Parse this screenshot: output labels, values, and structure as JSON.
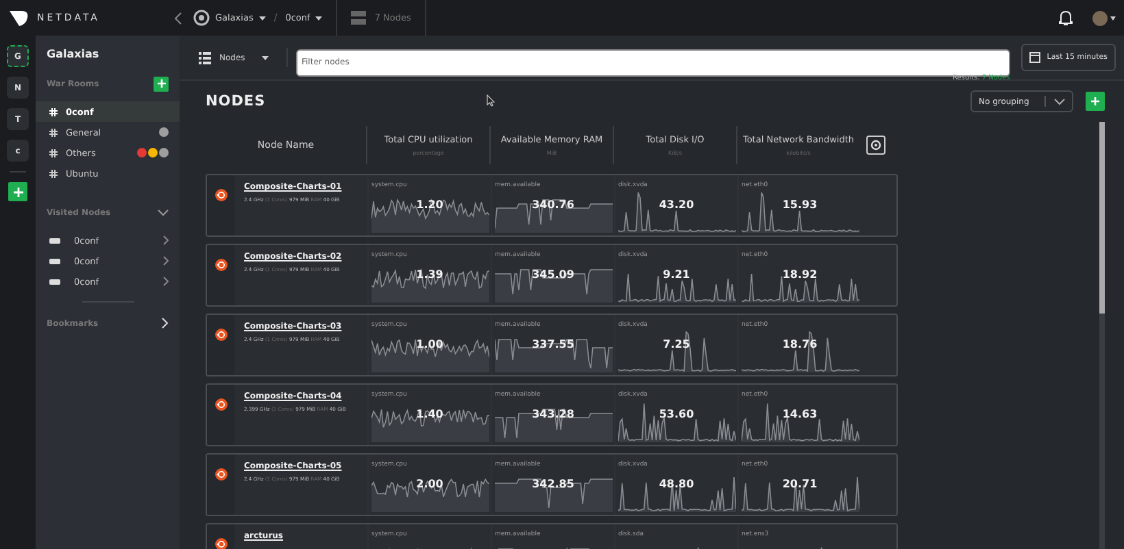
{
  "topbar": {
    "logo": "NETDATA",
    "space": "Galaxias",
    "separator": "/",
    "room": "0conf",
    "nodes_count": "7 Nodes"
  },
  "rail": [
    {
      "label": "G",
      "selected": true
    },
    {
      "label": "N",
      "selected": false
    },
    {
      "label": "T",
      "selected": false
    },
    {
      "label": "c",
      "selected": false
    }
  ],
  "sidebar": {
    "title": "Galaxias",
    "war_rooms_label": "War Rooms",
    "rooms": [
      {
        "name": "0conf",
        "selected": true
      },
      {
        "name": "General",
        "selected": false,
        "dots": [
          {
            "color": "#9e9e9e"
          }
        ]
      },
      {
        "name": "Others",
        "selected": false,
        "dots": [
          {
            "color": "#e53935"
          },
          {
            "color": "#f5b800"
          },
          {
            "color": "#9e9e9e"
          }
        ]
      },
      {
        "name": "Ubuntu",
        "selected": false
      }
    ],
    "visited_label": "Visited Nodes",
    "visited_expanded": true,
    "visited": [
      "0conf",
      "0conf",
      "0conf"
    ],
    "bookmarks_label": "Bookmarks"
  },
  "toolbar": {
    "view": "Nodes",
    "filter_placeholder": "Filter nodes",
    "time_range": "Last 15 minutes",
    "results_label": "Results:",
    "results_value": "7 Nodes"
  },
  "heading": "NODES",
  "grouping": "No grouping",
  "columns": [
    {
      "title": "Node Name"
    },
    {
      "title": "Total CPU utilization",
      "unit": "percentage"
    },
    {
      "title": "Available Memory RAM",
      "unit": "MiB"
    },
    {
      "title": "Total Disk I/O",
      "unit": "KiB/s"
    },
    {
      "title": "Total Network Bandwidth",
      "unit": "kilobits/s"
    }
  ],
  "nodes": [
    {
      "name": "Composite-Charts-01",
      "specs": [
        {
          "text": "2.4 GHz",
          "muted": false
        },
        {
          "text": "(1 Cores)",
          "muted": true
        },
        {
          "text": "979 MiB",
          "muted": false
        },
        {
          "text": "RAM",
          "muted": true
        },
        {
          "text": "40 GiB",
          "muted": false
        }
      ],
      "metrics": [
        {
          "label": "system.cpu",
          "value": "1.20"
        },
        {
          "label": "mem.available",
          "value": "340.76"
        },
        {
          "label": "disk.xvda",
          "value": "43.20"
        },
        {
          "label": "net.eth0",
          "value": "15.93"
        }
      ]
    },
    {
      "name": "Composite-Charts-02",
      "specs": [
        {
          "text": "2.4 GHz",
          "muted": false
        },
        {
          "text": "(1 Cores)",
          "muted": true
        },
        {
          "text": "979 MiB",
          "muted": false
        },
        {
          "text": "RAM",
          "muted": true
        },
        {
          "text": "40 GiB",
          "muted": false
        }
      ],
      "metrics": [
        {
          "label": "system.cpu",
          "value": "1.39"
        },
        {
          "label": "mem.available",
          "value": "345.09"
        },
        {
          "label": "disk.xvda",
          "value": "9.21"
        },
        {
          "label": "net.eth0",
          "value": "18.92"
        }
      ]
    },
    {
      "name": "Composite-Charts-03",
      "specs": [
        {
          "text": "2.4 GHz",
          "muted": false
        },
        {
          "text": "(1 Cores)",
          "muted": true
        },
        {
          "text": "979 MiB",
          "muted": false
        },
        {
          "text": "RAM",
          "muted": true
        },
        {
          "text": "40 GiB",
          "muted": false
        }
      ],
      "metrics": [
        {
          "label": "system.cpu",
          "value": "1.00"
        },
        {
          "label": "mem.available",
          "value": "337.55"
        },
        {
          "label": "disk.xvda",
          "value": "7.25"
        },
        {
          "label": "net.eth0",
          "value": "18.76"
        }
      ]
    },
    {
      "name": "Composite-Charts-04",
      "specs": [
        {
          "text": "2.399 GHz",
          "muted": false
        },
        {
          "text": "(1 Cores)",
          "muted": true
        },
        {
          "text": "979 MiB",
          "muted": false
        },
        {
          "text": "RAM",
          "muted": true
        },
        {
          "text": "40 GiB",
          "muted": false
        }
      ],
      "metrics": [
        {
          "label": "system.cpu",
          "value": "1.40"
        },
        {
          "label": "mem.available",
          "value": "343.28"
        },
        {
          "label": "disk.xvda",
          "value": "53.60"
        },
        {
          "label": "net.eth0",
          "value": "14.63"
        }
      ]
    },
    {
      "name": "Composite-Charts-05",
      "specs": [
        {
          "text": "2.4 GHz",
          "muted": false
        },
        {
          "text": "(1 Cores)",
          "muted": true
        },
        {
          "text": "979 MiB",
          "muted": false
        },
        {
          "text": "RAM",
          "muted": true
        },
        {
          "text": "40 GiB",
          "muted": false
        }
      ],
      "metrics": [
        {
          "label": "system.cpu",
          "value": "2.00"
        },
        {
          "label": "mem.available",
          "value": "342.85"
        },
        {
          "label": "disk.xvda",
          "value": "48.80"
        },
        {
          "label": "net.eth0",
          "value": "20.71"
        }
      ]
    },
    {
      "name": "arcturus",
      "metrics": [
        {
          "label": "system.cpu"
        },
        {
          "label": "mem.available"
        },
        {
          "label": "disk.sda"
        },
        {
          "label": "net.ens3"
        }
      ]
    }
  ]
}
